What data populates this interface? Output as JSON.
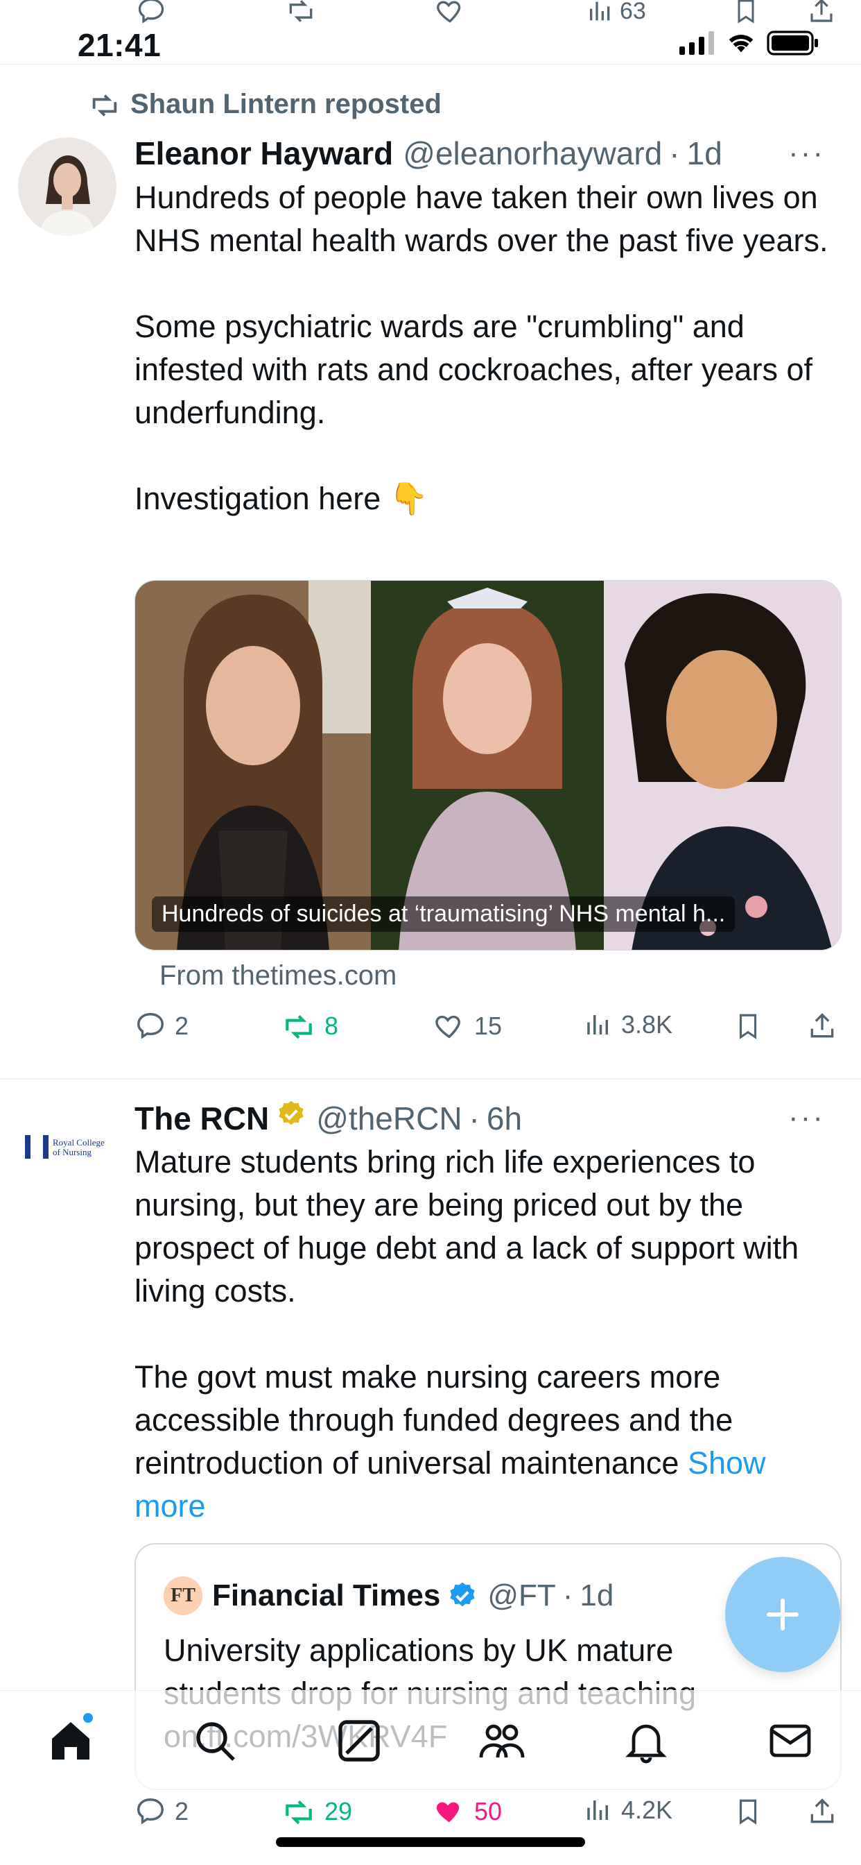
{
  "peek_actions": {
    "views": "63"
  },
  "status_bar": {
    "time": "21:41"
  },
  "tweet1": {
    "repost_label": "Shaun Lintern reposted",
    "name": "Eleanor Hayward",
    "handle": "@eleanorhayward",
    "time": "1d",
    "paragraphs": [
      "Hundreds of people have taken their own lives on NHS mental health wards over the past five years.",
      "Some psychiatric wards are \"crumbling\" and infested with rats and cockroaches, after years of underfunding.",
      "Investigation here 👇"
    ],
    "card_caption": "Hundreds of suicides at ‘traumatising’ NHS mental h...",
    "card_source": "From thetimes.com",
    "stats": {
      "replies": "2",
      "reposts": "8",
      "likes": "15",
      "views": "3.8K"
    }
  },
  "tweet2": {
    "name": "The RCN",
    "handle": "@theRCN",
    "time": "6h",
    "avatar_text": "Royal College of Nursing",
    "paragraphs": [
      "Mature students bring rich life experiences to nursing, but they are being priced out by the prospect of huge debt and a lack of support with living costs.",
      "The govt must make nursing careers more accessible through funded degrees and the reintroduction of universal maintenance "
    ],
    "show_more": "Show more",
    "quote": {
      "logo_text": "FT",
      "name": "Financial Times",
      "handle": "@FT",
      "time": "1d",
      "text": "University applications by UK mature students drop for nursing and teaching on.ft.com/3WKRV4F"
    },
    "stats": {
      "replies": "2",
      "reposts": "29",
      "likes": "50",
      "views": "4.2K"
    }
  },
  "colors": {
    "accent": "#1d9bf0",
    "repost_green": "#00ba7c",
    "like_pink": "#f91880",
    "muted": "#536471"
  }
}
